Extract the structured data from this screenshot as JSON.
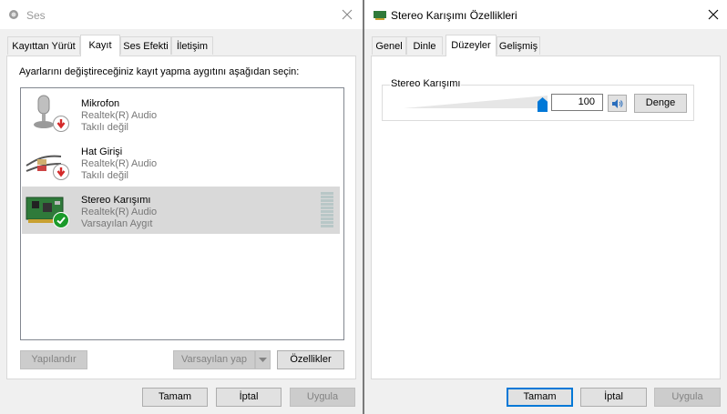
{
  "left_window": {
    "title": "Ses",
    "tabs": [
      "Kayıttan Yürüt",
      "Kayıt",
      "Ses Efekti",
      "İletişim"
    ],
    "instruction": "Ayarlarını değiştireceğiniz kayıt yapma aygıtını aşağıdan seçin:",
    "devices": [
      {
        "name": "Mikrofon",
        "driver": "Realtek(R) Audio",
        "status": "Takılı değil"
      },
      {
        "name": "Hat Girişi",
        "driver": "Realtek(R) Audio",
        "status": "Takılı değil"
      },
      {
        "name": "Stereo Karışımı",
        "driver": "Realtek(R) Audio",
        "status": "Varsayılan Aygıt"
      }
    ],
    "buttons": {
      "configure": "Yapılandır",
      "set_default": "Varsayılan yap",
      "properties": "Özellikler",
      "ok": "Tamam",
      "cancel": "İptal",
      "apply": "Uygula"
    }
  },
  "right_window": {
    "title": "Stereo Karışımı Özellikleri",
    "tabs": [
      "Genel",
      "Dinle",
      "Düzeyler",
      "Gelişmiş"
    ],
    "group_label": "Stereo Karışımı",
    "level_value": "100",
    "level_fraction": 1.0,
    "balance_label": "Denge",
    "buttons": {
      "ok": "Tamam",
      "cancel": "İptal",
      "apply": "Uygula"
    }
  },
  "colors": {
    "slider_thumb": "#0078d7",
    "default_badge": "#1a9a2a",
    "unplugged_badge": "#d42a2a"
  }
}
